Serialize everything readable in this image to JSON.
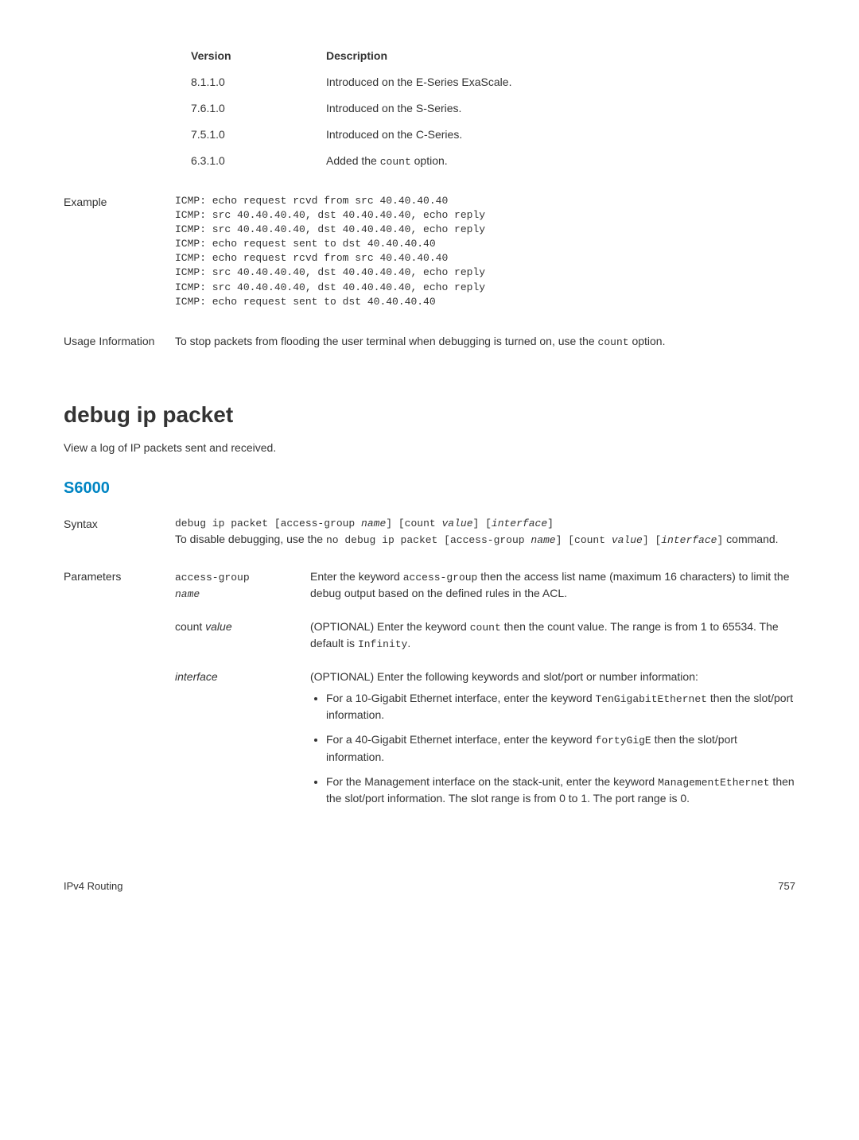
{
  "version_table": {
    "header_version": "Version",
    "header_description": "Description",
    "rows": [
      {
        "version": "8.1.1.0",
        "description": "Introduced on the E-Series ExaScale."
      },
      {
        "version": "7.6.1.0",
        "description": "Introduced on the S-Series."
      },
      {
        "version": "7.5.1.0",
        "description": "Introduced on the C-Series."
      },
      {
        "version": "6.3.1.0",
        "description_pre": "Added the ",
        "description_code": "count",
        "description_post": " option."
      }
    ]
  },
  "example": {
    "label": "Example",
    "code": "ICMP: echo request rcvd from src 40.40.40.40\nICMP: src 40.40.40.40, dst 40.40.40.40, echo reply\nICMP: src 40.40.40.40, dst 40.40.40.40, echo reply\nICMP: echo request sent to dst 40.40.40.40\nICMP: echo request rcvd from src 40.40.40.40\nICMP: src 40.40.40.40, dst 40.40.40.40, echo reply\nICMP: src 40.40.40.40, dst 40.40.40.40, echo reply\nICMP: echo request sent to dst 40.40.40.40"
  },
  "usage": {
    "label": "Usage Information",
    "text_pre": "To stop packets from flooding the user terminal when debugging is turned on, use the ",
    "text_code": "count",
    "text_post": " option."
  },
  "command": {
    "title": "debug ip packet",
    "subtitle": "View a log of IP packets sent and received.",
    "platform": "S6000"
  },
  "syntax": {
    "label": "Syntax",
    "line1_code": "debug ip packet [access-group ",
    "line1_italic1": "name",
    "line1_code2": "] [count ",
    "line1_italic2": "value",
    "line1_code3": "] [",
    "line1_italic3": "interface",
    "line1_code4": "]",
    "line2_pre": "To disable debugging, use the ",
    "line2_code1": "no debug ip packet [access-group ",
    "line2_italic1": "name",
    "line2_code2": "] [count ",
    "line2_italic2": "value",
    "line2_code3": "] [",
    "line2_italic3": "interface",
    "line2_code4": "]",
    "line2_post": " command."
  },
  "parameters": {
    "label": "Parameters",
    "items": [
      {
        "name_code": "access-group",
        "name_italic": "name",
        "desc_pre": "Enter the keyword ",
        "desc_code": "access-group",
        "desc_post": " then the access list name (maximum 16 characters) to limit the debug output based on the defined rules in the ACL."
      },
      {
        "name_plain": "count ",
        "name_italic": "value",
        "desc_pre": "(OPTIONAL) Enter the keyword ",
        "desc_code": "count",
        "desc_mid": " then the count value. The range is from 1 to 65534. The default is ",
        "desc_code2": "Infinity",
        "desc_post": "."
      },
      {
        "name_italic_only": "interface",
        "desc_plain": "(OPTIONAL) Enter the following keywords and slot/port or number information:",
        "bullets": [
          {
            "pre": "For a 10-Gigabit Ethernet interface, enter the keyword ",
            "code": "TenGigabitEthernet",
            "post": " then the slot/port information."
          },
          {
            "pre": "For a 40-Gigabit Ethernet interface, enter the keyword ",
            "code": "fortyGigE",
            "post": " then the slot/port information."
          },
          {
            "pre": "For the Management interface on the stack-unit, enter the keyword ",
            "code": "ManagementEthernet",
            "post": " then the slot/port information. The slot range is from 0 to 1. The port range is 0."
          }
        ]
      }
    ]
  },
  "footer": {
    "left": "IPv4 Routing",
    "right": "757"
  }
}
